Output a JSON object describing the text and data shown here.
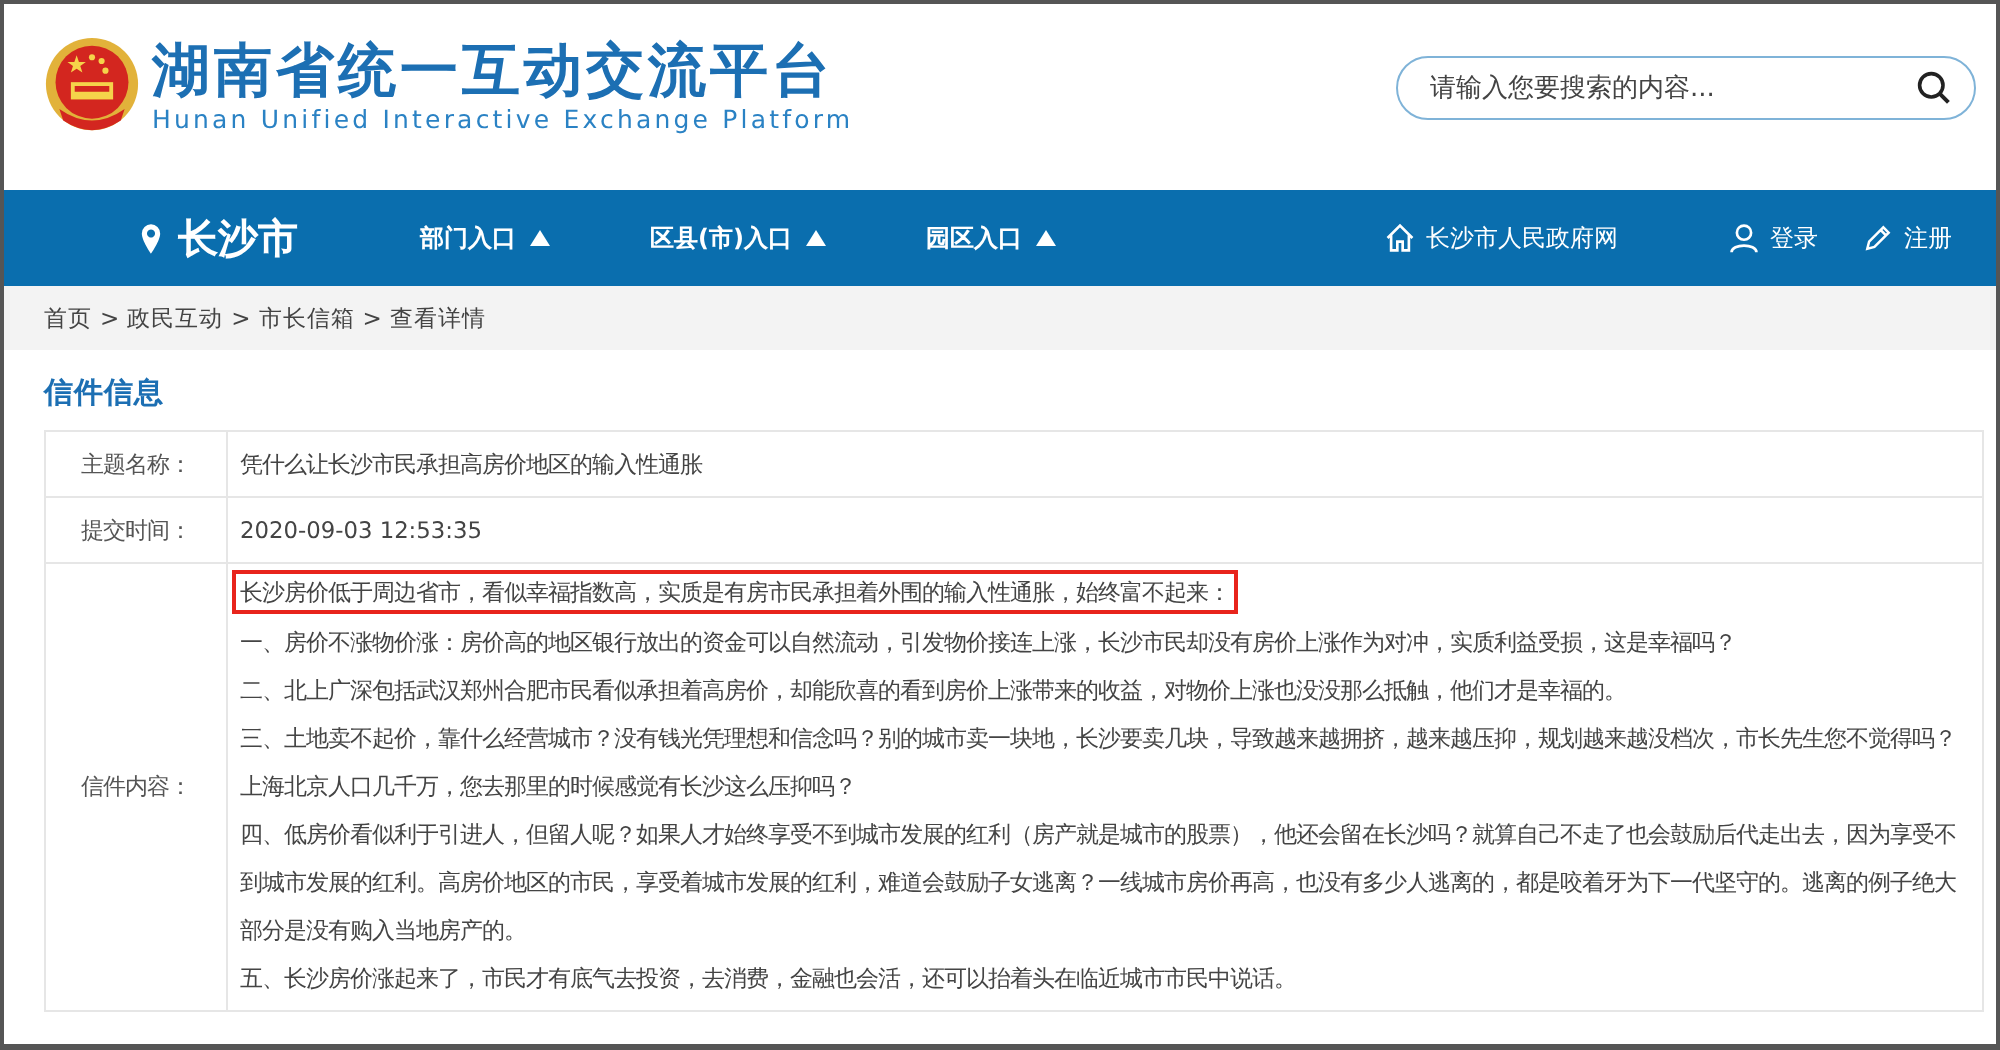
{
  "site": {
    "title": "湖南省统一互动交流平台",
    "subtitle": "Hunan Unified Interactive Exchange Platform"
  },
  "search": {
    "placeholder": "请输入您要搜索的内容..."
  },
  "nav": {
    "city": "长沙市",
    "menus": [
      "部门入口",
      "区县(市)入口",
      "园区入口"
    ],
    "links": [
      {
        "kind": "home",
        "label": "长沙市人民政府网"
      },
      {
        "kind": "user",
        "label": "登录"
      },
      {
        "kind": "pencil",
        "label": "注册"
      }
    ]
  },
  "breadcrumb": {
    "separator": ">",
    "items": [
      "首页",
      "政民互动",
      "市长信箱",
      "查看详情"
    ]
  },
  "section_title": "信件信息",
  "fields": [
    {
      "label": "主题名称：",
      "kind": "text",
      "value": "凭什么让长沙市民承担高房价地区的输入性通胀"
    },
    {
      "label": "提交时间：",
      "kind": "text",
      "value": "2020-09-03 12:53:35"
    },
    {
      "label": "信件内容：",
      "kind": "paragraphs",
      "paragraphs": [
        {
          "text": "长沙房价低于周边省市，看似幸福指数高，实质是有房市民承担着外围的输入性通胀，始终富不起来：",
          "highlighted": true
        },
        {
          "text": "一、房价不涨物价涨：房价高的地区银行放出的资金可以自然流动，引发物价接连上涨，长沙市民却没有房价上涨作为对冲，实质利益受损，这是幸福吗？",
          "highlighted": false
        },
        {
          "text": "二、北上广深包括武汉郑州合肥市民看似承担着高房价，却能欣喜的看到房价上涨带来的收益，对物价上涨也没没那么抵触，他们才是幸福的。",
          "highlighted": false
        },
        {
          "text": "三、土地卖不起价，靠什么经营城市？没有钱光凭理想和信念吗？别的城市卖一块地，长沙要卖几块，导致越来越拥挤，越来越压抑，规划越来越没档次，市长先生您不觉得吗？上海北京人口几千万，您去那里的时候感觉有长沙这么压抑吗？",
          "highlighted": false
        },
        {
          "text": "四、低房价看似利于引进人，但留人呢？如果人才始终享受不到城市发展的红利（房产就是城市的股票），他还会留在长沙吗？就算自己不走了也会鼓励后代走出去，因为享受不到城市发展的红利。高房价地区的市民，享受着城市发展的红利，难道会鼓励子女逃离？一线城市房价再高，也没有多少人逃离的，都是咬着牙为下一代坚守的。逃离的例子绝大部分是没有购入当地房产的。",
          "highlighted": false
        },
        {
          "text": "五、长沙房价涨起来了，市民才有底气去投资，去消费，金融也会活，还可以抬着头在临近城市市民中说话。",
          "highlighted": false
        }
      ]
    }
  ]
}
